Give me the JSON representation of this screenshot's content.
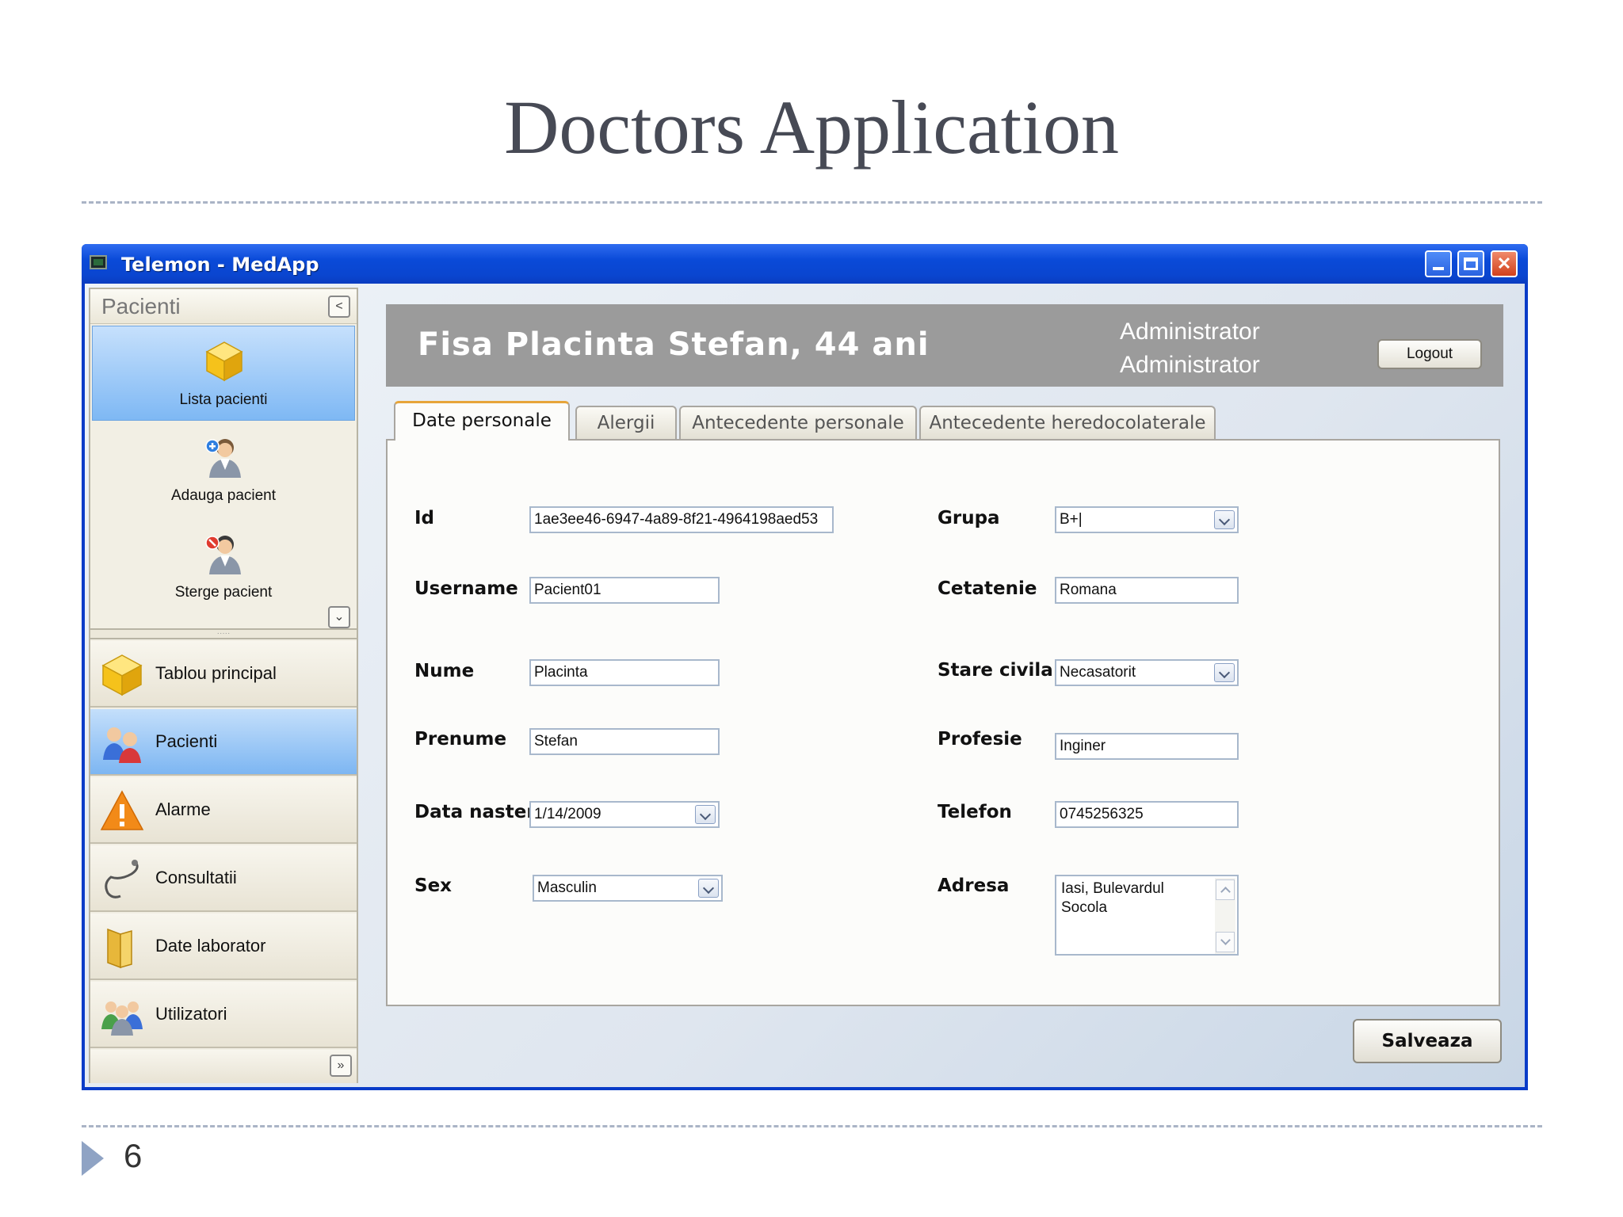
{
  "slide": {
    "title": "Doctors Application",
    "page_number": "6"
  },
  "window": {
    "title": "Telemon - MedApp"
  },
  "nav": {
    "section_title": "Pacienti",
    "sub_items": [
      {
        "label": "Lista pacienti",
        "icon": "cube-icon",
        "active": true
      },
      {
        "label": "Adauga pacient",
        "icon": "add-user-icon",
        "active": false
      },
      {
        "label": "Sterge pacient",
        "icon": "remove-user-icon",
        "active": false
      }
    ],
    "items": [
      {
        "label": "Tablou principal",
        "icon": "cube-icon",
        "active": false
      },
      {
        "label": "Pacienti",
        "icon": "patients-icon",
        "active": true
      },
      {
        "label": "Alarme",
        "icon": "warning-icon",
        "active": false
      },
      {
        "label": "Consultatii",
        "icon": "stethoscope-icon",
        "active": false
      },
      {
        "label": "Date laborator",
        "icon": "folder-icon",
        "active": false
      },
      {
        "label": "Utilizatori",
        "icon": "users-icon",
        "active": false
      }
    ]
  },
  "header": {
    "patient_title": "Fisa  Placinta Stefan, 44 ani",
    "user_line1": "Administrator",
    "user_line2": "Administrator",
    "logout_label": "Logout"
  },
  "tabs": [
    {
      "label": "Date personale",
      "active": true
    },
    {
      "label": "Alergii",
      "active": false
    },
    {
      "label": "Antecedente personale",
      "active": false
    },
    {
      "label": "Antecedente heredocolaterale",
      "active": false
    }
  ],
  "form": {
    "id": {
      "label": "Id",
      "value": "1ae3ee46-6947-4a89-8f21-4964198aed53"
    },
    "username": {
      "label": "Username",
      "value": "Pacient01"
    },
    "nume": {
      "label": "Nume",
      "value": "Placinta"
    },
    "prenume": {
      "label": "Prenume",
      "value": "Stefan"
    },
    "data_nasterii": {
      "label": "Data nasterii",
      "value": "1/14/2009"
    },
    "sex": {
      "label": "Sex",
      "value": "Masculin"
    },
    "grupa": {
      "label": "Grupa",
      "value": "B+|"
    },
    "cetatenie": {
      "label": "Cetatenie",
      "value": "Romana"
    },
    "stare_civila": {
      "label": "Stare civila",
      "value": "Necasatorit"
    },
    "profesie": {
      "label": "Profesie",
      "value": "Inginer"
    },
    "telefon": {
      "label": "Telefon",
      "value": "0745256325"
    },
    "adresa": {
      "label": "Adresa",
      "line1": "Iasi, Bulevardul",
      "line2": "Socola"
    }
  },
  "save_label": "Salveaza",
  "colors": {
    "titlebar": "#0a4ad8",
    "header_band": "#9b9b9b",
    "nav_active": "#7eb8f4",
    "tab_active_accent": "#e7a53a"
  }
}
